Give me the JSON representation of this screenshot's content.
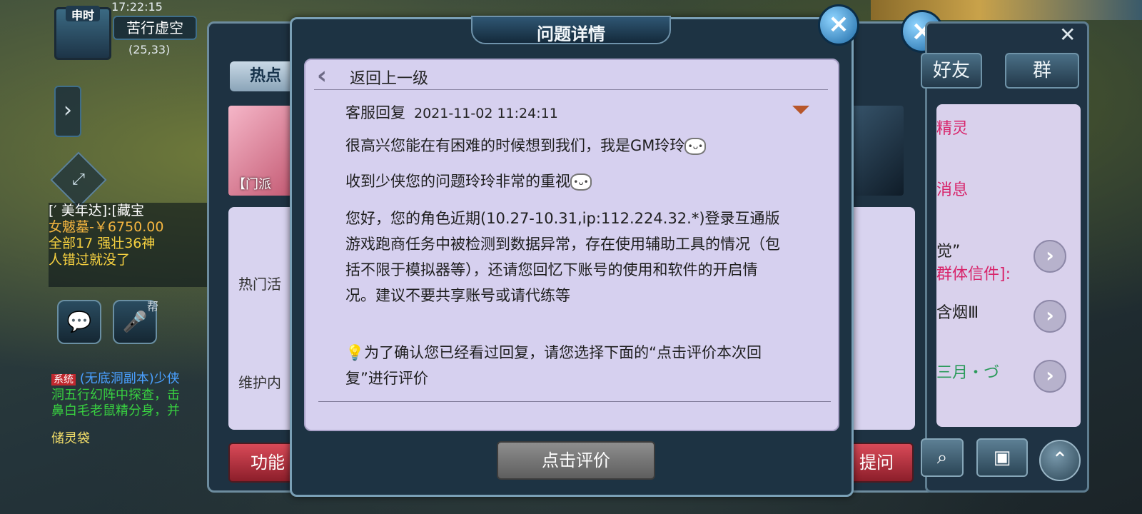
{
  "hud": {
    "time_label": "申时",
    "clock": "17:22:15",
    "player_name": "苦行虚空",
    "coords": "(25,33)"
  },
  "chat": {
    "lines": [
      {
        "text": "[′ 美年达]:[藏宝",
        "color": "#ffffff"
      },
      {
        "text": "女魃墓-￥6750.00",
        "color": "#f5b640"
      },
      {
        "text": "全部17 强壮36神",
        "color": "#f5d040"
      },
      {
        "text": "人错过就没了",
        "color": "#f5d040"
      }
    ],
    "voice_label": "帮",
    "system_tag": "系统",
    "system_lines": [
      "(无底洞副本)少侠",
      "洞五行幻阵中探查，击",
      "鼻白毛老鼠精分身，并"
    ],
    "storage_bag": "储灵袋"
  },
  "back_panel": {
    "tab_hot": "热点",
    "banner_left": "【门派",
    "label_hot_activity": "热门活",
    "label_maintenance": "维护内",
    "btn_function": "功能",
    "btn_ask": "提问"
  },
  "right_panel": {
    "tab_friends": "好友",
    "tab_group": "群",
    "items": [
      {
        "text": "精灵",
        "color": "#d8246a"
      },
      {
        "text": "消息",
        "color": "#d8246a"
      },
      {
        "text": "觉”",
        "color": "#222222"
      },
      {
        "text": "群体信件]:",
        "color": "#d8246a"
      },
      {
        "text": "含烟Ⅲ",
        "color": "#222222"
      },
      {
        "text": "三月・づ",
        "color": "#2a9a5a"
      }
    ]
  },
  "dialog": {
    "title": "问题详情",
    "back_label": "返回上一级",
    "sender": "客服回复",
    "timestamp": "2021-11-02 11:24:11",
    "para1": "很高兴您能在有困难的时候想到我们，我是GM玲玲",
    "para2": "收到少侠您的问题玲玲非常的重视",
    "para3": "您好，您的角色近期(10.27-10.31,ip:112.224.32.*)登录互通版游戏跑商任务中被检测到数据异常，存在使用辅助工具的情况（包括不限于模拟器等），还请您回忆下账号的使用和软件的开启情况。建议不要共享账号或请代练等",
    "para4": "为了确认您已经看过回复，请您选择下面的“点击评价本次回复”进行评价",
    "rate_button": "点击评价"
  }
}
